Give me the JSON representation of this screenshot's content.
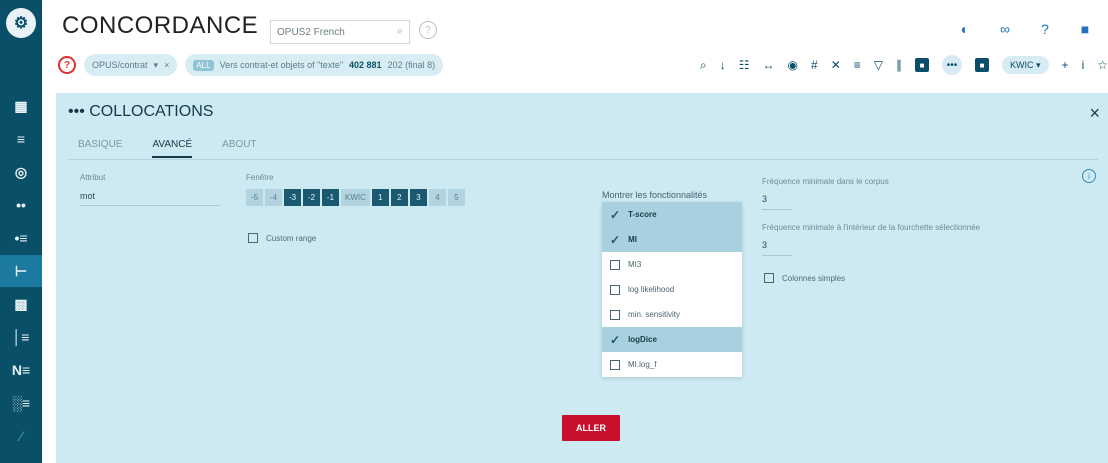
{
  "app": {
    "title": "CONCORDANCE",
    "logo_glyph": "⚙",
    "corpus_select": "OPUS2 French",
    "help_glyph": "?"
  },
  "sidebar": {
    "items": [
      {
        "glyph": "▦",
        "name": "dashboard-icon"
      },
      {
        "glyph": "≡",
        "name": "list-icon"
      },
      {
        "glyph": "◎",
        "name": "target-icon"
      },
      {
        "glyph": "••",
        "name": "nodes-icon"
      },
      {
        "glyph": "•≡",
        "name": "sort-icon"
      },
      {
        "glyph": "⊢",
        "name": "collocations-icon"
      },
      {
        "glyph": "▩",
        "name": "grid-icon"
      },
      {
        "glyph": "│≡",
        "name": "frequency-icon"
      },
      {
        "glyph": "N≡",
        "name": "ngram-icon"
      },
      {
        "glyph": "░≡",
        "name": "text-type-icon"
      },
      {
        "glyph": "∕",
        "name": "graph-icon"
      }
    ]
  },
  "header_icons": [
    {
      "glyph": "◐",
      "name": "theme-icon"
    },
    {
      "glyph": "∞",
      "name": "link-icon"
    },
    {
      "glyph": "?",
      "name": "help-icon"
    },
    {
      "glyph": "■",
      "name": "feedback-icon"
    }
  ],
  "query": {
    "icon_glyph": "?",
    "chip1": "OPUS/contrat",
    "chip1_close": "×",
    "chip1_caret": "▾",
    "chip2_tag": "ALL",
    "chip2_text": "Vers contrat-et objets of \"texte\"",
    "chip2_count": "402 881",
    "chip2_extra": "202 (final 8)"
  },
  "toolbar": {
    "icons": [
      {
        "glyph": "⌕",
        "name": "search-icon"
      },
      {
        "glyph": "↓",
        "name": "download-icon"
      },
      {
        "glyph": "☷",
        "name": "view-icon"
      },
      {
        "glyph": "↔",
        "name": "swap-icon"
      },
      {
        "glyph": "◉",
        "name": "eye-icon"
      },
      {
        "glyph": "#",
        "name": "hash-icon"
      },
      {
        "glyph": "✕",
        "name": "shuffle-icon"
      },
      {
        "glyph": "≡",
        "name": "sort-icon"
      },
      {
        "glyph": "▽",
        "name": "filter-icon"
      },
      {
        "glyph": "∥",
        "name": "columns-icon"
      }
    ],
    "sq1": "■",
    "more": "•••",
    "sq2": "■",
    "kwic": "KWIC ▾",
    "plus": "+",
    "info": "i",
    "star": "☆"
  },
  "panel": {
    "title": "••• COLLOCATIONS",
    "close": "×",
    "tabs": [
      "BASIQUE",
      "AVANCÉ",
      "ABOUT"
    ],
    "attribute_label": "Attribut",
    "attribute_value": "mot",
    "window_label": "Fenêtre",
    "range": [
      {
        "text": "-5",
        "on": false
      },
      {
        "text": "-4",
        "on": false
      },
      {
        "text": "-3",
        "on": true
      },
      {
        "text": "-2",
        "on": true
      },
      {
        "text": "-1",
        "on": true
      },
      {
        "text": "KWIC",
        "on": false
      },
      {
        "text": "1",
        "on": true
      },
      {
        "text": "2",
        "on": true
      },
      {
        "text": "3",
        "on": true
      },
      {
        "text": "4",
        "on": false
      },
      {
        "text": "5",
        "on": false
      }
    ],
    "custom_range": "Custom range",
    "measures_label": "Montrer les fonctionnalités",
    "measures": [
      {
        "label": "T-score",
        "selected": true
      },
      {
        "label": "MI",
        "selected": true
      },
      {
        "label": "MI3",
        "selected": false
      },
      {
        "label": "log likelihood",
        "selected": false
      },
      {
        "label": "min. sensitivity",
        "selected": false
      },
      {
        "label": "logDice",
        "selected": true
      },
      {
        "label": "MI.log_f",
        "selected": false
      }
    ],
    "freq_corpus_label": "Fréquence minimale dans le corpus",
    "freq_corpus_value": "3",
    "freq_range_label": "Fréquence minimale à l'intérieur de la fourchette sélectionnée",
    "freq_range_value": "3",
    "case_label": "Colonnes simples",
    "info_glyph": "i",
    "go": "ALLER"
  }
}
